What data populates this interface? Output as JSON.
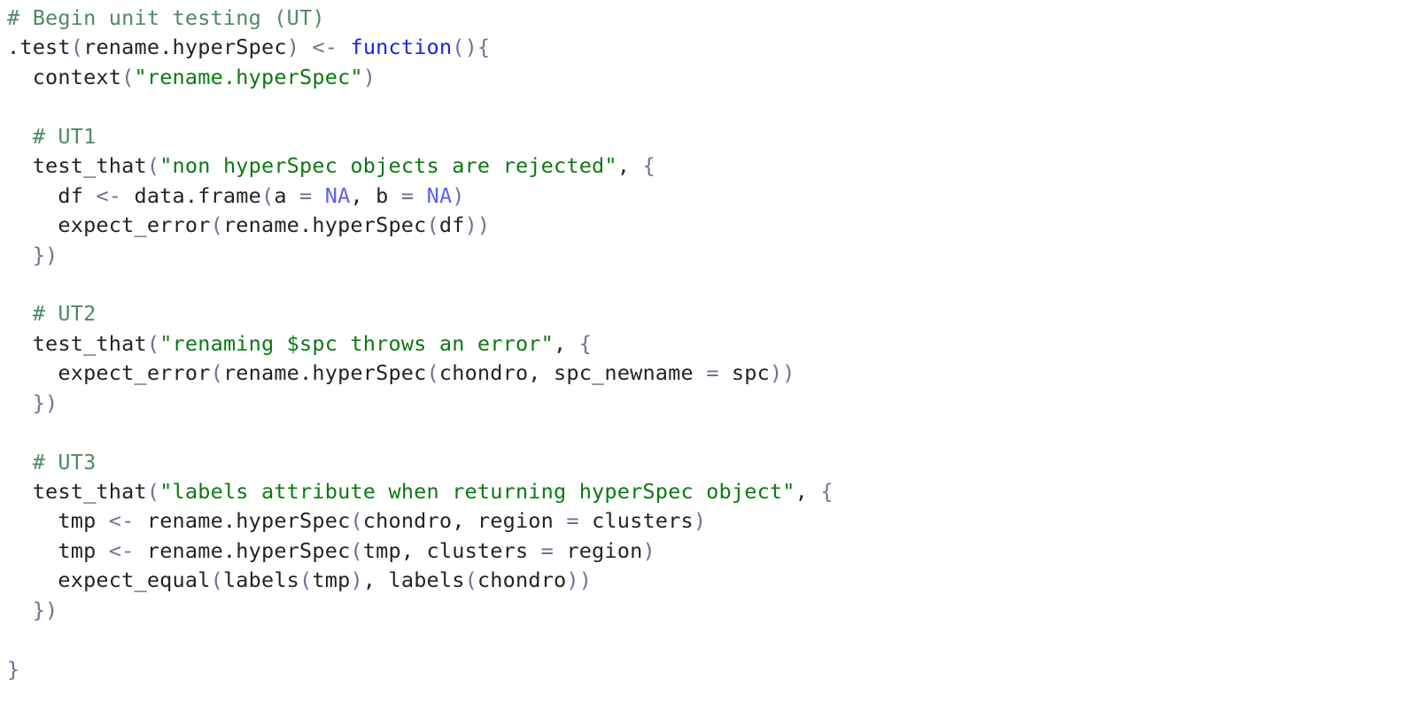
{
  "editor": {
    "language": "r",
    "colors": {
      "background": "#ffffff",
      "plain": "#1f2328",
      "comment": "#4f8a63",
      "string": "#0b7a12",
      "keyword": "#1c23e3",
      "punctuation": "#6b7390",
      "operator": "#6b7390",
      "constant": "#5b63ea"
    },
    "lines": [
      [
        {
          "t": "comment",
          "v": "# Begin unit testing (UT)"
        }
      ],
      [
        {
          "t": "plain",
          "v": ".test"
        },
        {
          "t": "punct",
          "v": "("
        },
        {
          "t": "plain",
          "v": "rename.hyperSpec"
        },
        {
          "t": "punct",
          "v": ")"
        },
        {
          "t": "plain",
          "v": " "
        },
        {
          "t": "op",
          "v": "<-"
        },
        {
          "t": "plain",
          "v": " "
        },
        {
          "t": "keyword",
          "v": "function"
        },
        {
          "t": "punct",
          "v": "(){"
        }
      ],
      [
        {
          "t": "plain",
          "v": "  context"
        },
        {
          "t": "punct",
          "v": "("
        },
        {
          "t": "string",
          "v": "\"rename.hyperSpec\""
        },
        {
          "t": "punct",
          "v": ")"
        }
      ],
      [],
      [
        {
          "t": "comment",
          "v": "  # UT1"
        }
      ],
      [
        {
          "t": "plain",
          "v": "  test_that"
        },
        {
          "t": "punct",
          "v": "("
        },
        {
          "t": "string",
          "v": "\"non hyperSpec objects are rejected\""
        },
        {
          "t": "plain",
          "v": ", "
        },
        {
          "t": "punct",
          "v": "{"
        }
      ],
      [
        {
          "t": "plain",
          "v": "    df "
        },
        {
          "t": "op",
          "v": "<-"
        },
        {
          "t": "plain",
          "v": " data.frame"
        },
        {
          "t": "punct",
          "v": "("
        },
        {
          "t": "plain",
          "v": "a "
        },
        {
          "t": "op",
          "v": "="
        },
        {
          "t": "plain",
          "v": " "
        },
        {
          "t": "constant",
          "v": "NA"
        },
        {
          "t": "plain",
          "v": ", b "
        },
        {
          "t": "op",
          "v": "="
        },
        {
          "t": "plain",
          "v": " "
        },
        {
          "t": "constant",
          "v": "NA"
        },
        {
          "t": "punct",
          "v": ")"
        }
      ],
      [
        {
          "t": "plain",
          "v": "    expect_error"
        },
        {
          "t": "punct",
          "v": "("
        },
        {
          "t": "plain",
          "v": "rename.hyperSpec"
        },
        {
          "t": "punct",
          "v": "("
        },
        {
          "t": "plain",
          "v": "df"
        },
        {
          "t": "punct",
          "v": "))"
        }
      ],
      [
        {
          "t": "plain",
          "v": "  "
        },
        {
          "t": "punct",
          "v": "})"
        }
      ],
      [],
      [
        {
          "t": "comment",
          "v": "  # UT2"
        }
      ],
      [
        {
          "t": "plain",
          "v": "  test_that"
        },
        {
          "t": "punct",
          "v": "("
        },
        {
          "t": "string",
          "v": "\"renaming $spc throws an error\""
        },
        {
          "t": "plain",
          "v": ", "
        },
        {
          "t": "punct",
          "v": "{"
        }
      ],
      [
        {
          "t": "plain",
          "v": "    expect_error"
        },
        {
          "t": "punct",
          "v": "("
        },
        {
          "t": "plain",
          "v": "rename.hyperSpec"
        },
        {
          "t": "punct",
          "v": "("
        },
        {
          "t": "plain",
          "v": "chondro, spc_newname "
        },
        {
          "t": "op",
          "v": "="
        },
        {
          "t": "plain",
          "v": " spc"
        },
        {
          "t": "punct",
          "v": "))"
        }
      ],
      [
        {
          "t": "plain",
          "v": "  "
        },
        {
          "t": "punct",
          "v": "})"
        }
      ],
      [],
      [
        {
          "t": "comment",
          "v": "  # UT3"
        }
      ],
      [
        {
          "t": "plain",
          "v": "  test_that"
        },
        {
          "t": "punct",
          "v": "("
        },
        {
          "t": "string",
          "v": "\"labels attribute when returning hyperSpec object\""
        },
        {
          "t": "plain",
          "v": ", "
        },
        {
          "t": "punct",
          "v": "{"
        }
      ],
      [
        {
          "t": "plain",
          "v": "    tmp "
        },
        {
          "t": "op",
          "v": "<-"
        },
        {
          "t": "plain",
          "v": " rename.hyperSpec"
        },
        {
          "t": "punct",
          "v": "("
        },
        {
          "t": "plain",
          "v": "chondro, region "
        },
        {
          "t": "op",
          "v": "="
        },
        {
          "t": "plain",
          "v": " clusters"
        },
        {
          "t": "punct",
          "v": ")"
        }
      ],
      [
        {
          "t": "plain",
          "v": "    tmp "
        },
        {
          "t": "op",
          "v": "<-"
        },
        {
          "t": "plain",
          "v": " rename.hyperSpec"
        },
        {
          "t": "punct",
          "v": "("
        },
        {
          "t": "plain",
          "v": "tmp, clusters "
        },
        {
          "t": "op",
          "v": "="
        },
        {
          "t": "plain",
          "v": " region"
        },
        {
          "t": "punct",
          "v": ")"
        }
      ],
      [
        {
          "t": "plain",
          "v": "    expect_equal"
        },
        {
          "t": "punct",
          "v": "("
        },
        {
          "t": "plain",
          "v": "labels"
        },
        {
          "t": "punct",
          "v": "("
        },
        {
          "t": "plain",
          "v": "tmp"
        },
        {
          "t": "punct",
          "v": ")"
        },
        {
          "t": "plain",
          "v": ", labels"
        },
        {
          "t": "punct",
          "v": "("
        },
        {
          "t": "plain",
          "v": "chondro"
        },
        {
          "t": "punct",
          "v": "))"
        }
      ],
      [
        {
          "t": "plain",
          "v": "  "
        },
        {
          "t": "punct",
          "v": "})"
        }
      ],
      [],
      [
        {
          "t": "punct",
          "v": "}"
        }
      ]
    ]
  }
}
